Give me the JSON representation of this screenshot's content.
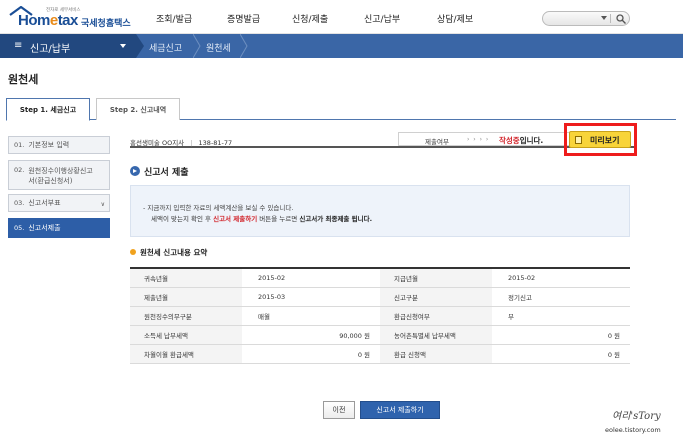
{
  "header": {
    "logo_sub": "전자로 세무서비스",
    "logo_part1": "Hom",
    "logo_e": "e",
    "logo_part2": "tax",
    "logo_korean": "국세청홈택스",
    "nav": [
      "조회/발급",
      "증명발급",
      "신청/제출",
      "신고/납부",
      "상담/제보"
    ],
    "search_icon": "magnifier-icon"
  },
  "menubar": {
    "menu_label": "신고/납부",
    "breadcrumb": [
      "세금신고",
      "원천세"
    ]
  },
  "page": {
    "title": "원천세"
  },
  "tabs": [
    {
      "label": "Step 1. 세금신고",
      "active": true
    },
    {
      "label": "Step 2. 신고내역",
      "active": false
    }
  ],
  "steps": [
    {
      "num": "01.",
      "label": "기본정보 입력"
    },
    {
      "num": "02.",
      "label_line1": "원천징수이행상황신고",
      "label_line2": "서(환급신청서)"
    },
    {
      "num": "03.",
      "label": "신고서부표"
    },
    {
      "num": "05.",
      "label": "신고서제출",
      "active": true
    }
  ],
  "info": {
    "company": "홍선생미술 OO지사",
    "sep": "|",
    "biz_no": "138-81-77",
    "status_label": "제출여부",
    "status_arrows": "› › › ›",
    "status_value_red": "작성중",
    "status_value_rest": "입니다.",
    "preview_label": "미리보기"
  },
  "section": {
    "title": "신고서 제출",
    "notice_line1": "- 지금까지 입력한 자료의 세액계산을 보실 수 있습니다.",
    "notice_line2_a": "세액이 맞는지 확인 후 ",
    "notice_line2_red": "신고서 제출하기",
    "notice_line2_b": " 버튼을 누르면 ",
    "notice_line2_bold": "신고서가 최종제출 됩니다."
  },
  "summary": {
    "title": "원천세 신고내용 요약",
    "rows": [
      [
        {
          "k": "귀속년월",
          "v": "2015-02"
        },
        {
          "k": "지급년월",
          "v": "2015-02"
        }
      ],
      [
        {
          "k": "제출년월",
          "v": "2015-03"
        },
        {
          "k": "신고구분",
          "v": "정기신고"
        }
      ],
      [
        {
          "k": "원천징수의무구분",
          "v": "매월"
        },
        {
          "k": "환급신청여부",
          "v": "부"
        }
      ],
      [
        {
          "k": "소득세 납부세액",
          "v": "90,000 원"
        },
        {
          "k": "농어촌특별세 납부세액",
          "v": "0 원"
        }
      ],
      [
        {
          "k": "차월이월 환급세액",
          "v": "0 원"
        },
        {
          "k": "환급 신청액",
          "v": "0 원"
        }
      ]
    ]
  },
  "buttons": {
    "prev": "이전",
    "submit": "신고서 제출하기"
  },
  "watermark": {
    "line1": "여리'sTory",
    "line2": "eolee.tistory.com"
  },
  "colors": {
    "brand_blue": "#1a4e96",
    "bar_blue": "#3a66a6",
    "bar_dark": "#22487f",
    "highlight_red": "#ee1c1c",
    "preview_yellow": "#f8d43a",
    "status_red": "#d2232a"
  }
}
